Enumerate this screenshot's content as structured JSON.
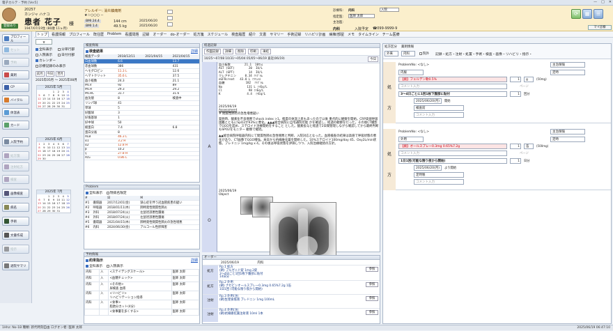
{
  "window": {
    "title": "電子カルテ - 予約 [Ver5]",
    "controls": [
      "—",
      "□",
      "✕"
    ]
  },
  "patient": {
    "id": "20257",
    "kana": "カンジャ ハナコ",
    "name": "患者 花子",
    "honorific": "様",
    "birth": "1947/07/19生 (80歳 11ヶ月)",
    "allergy_label": "アレルギー: 消炎鎮痛剤",
    "stars": "★☆○○○ --",
    "height": "144 cm",
    "weight": "49.5 kg",
    "date1": "2025/06/20",
    "date2": "2025/06/20",
    "badge": "登録あり",
    "bmi1": "BMI 24.4",
    "bmi2": "BMI 1.4",
    "insurance_label": "保険:",
    "insurance": "内科",
    "consult_label": "診療科:",
    "consult": "内科",
    "dept_label": "指定医:",
    "dept": "医師 太郎",
    "disease_label": "主治医:",
    "disease": "",
    "ward": "入院",
    "admit": "入院予定",
    "phone": "☎099-9999-9",
    "ward_label": "内科",
    "settings_label": "マイ診察",
    "colors": {
      "header": "#fbefcc",
      "accent": "#3b78c5",
      "pink": "#fde4e4"
    }
  },
  "tabs": [
    "トップ",
    "看護情報",
    "プロフィール",
    "既往歴",
    "Problem",
    "看護問題",
    "記録",
    "オーダー",
    "do-オーダー",
    "処方箋",
    "スケジュール",
    "検査履歴",
    "紹介",
    "文書",
    "サマリー",
    "手術記録",
    "リハビリ計画",
    "病棟/部屋",
    "メモ",
    "タイムライン",
    "チーム医療"
  ],
  "leftnav": [
    {
      "label": "プロフィール",
      "icon": "profile-icon",
      "color": "#4a7bc0",
      "enabled": true
    },
    {
      "label": "セット",
      "icon": "set-icon",
      "color": "#6aa4d8",
      "enabled": false
    },
    {
      "label": "予約",
      "icon": "calendar-icon",
      "color": "#7c8fa8",
      "enabled": false
    },
    {
      "label": "薬剤",
      "icon": "drug-icon",
      "color": "#c94a4a",
      "enabled": true
    },
    {
      "label": "CP",
      "icon": "cp-icon",
      "color": "#3b5fa8",
      "enabled": true
    },
    {
      "label": "バイタル",
      "icon": "vital-icon",
      "color": "#d77a2b",
      "enabled": true
    },
    {
      "label": "体温表",
      "icon": "chart-icon",
      "color": "#5a9bd5",
      "enabled": true
    },
    {
      "label": "カード",
      "icon": "card-icon",
      "color": "#5aa06a",
      "enabled": true
    },
    {
      "label": "入院予約",
      "icon": "admission-icon",
      "color": "#7a8aa0",
      "enabled": true
    },
    {
      "label": "処方箋",
      "icon": "prescription-icon",
      "color": "#98a",
      "enabled": false
    },
    {
      "label": "注射処方",
      "icon": "injection-icon",
      "color": "#98a",
      "enabled": false
    },
    {
      "label": "検査",
      "icon": "lab-icon",
      "color": "#98a",
      "enabled": false
    },
    {
      "label": "画像検査",
      "icon": "image-icon",
      "color": "#557",
      "enabled": true
    },
    {
      "label": "病名",
      "icon": "disease-icon",
      "color": "#885",
      "enabled": true
    },
    {
      "label": "手術",
      "icon": "surgery-icon",
      "color": "#353",
      "enabled": true
    },
    {
      "label": "文書作成",
      "icon": "doc-icon",
      "color": "#555",
      "enabled": true
    },
    {
      "label": "指示",
      "icon": "order-icon",
      "color": "#777",
      "enabled": false
    },
    {
      "label": "退院サマリ",
      "icon": "summary-icon",
      "color": "#777",
      "enabled": true
    }
  ],
  "filters": {
    "all": "全科表示",
    "admission": "入院表示",
    "calendar": "カレンダー",
    "sub": "分単行部",
    "date": "日付付部",
    "diag": "診療記録のみ表示",
    "period_from": "2025年05月",
    "period_to": "2025年08月",
    "prev": "前月",
    "next": "翌月",
    "today": "今日"
  },
  "calendars": [
    {
      "title": "2025年 5月",
      "days": [
        "",
        "",
        "",
        "1",
        "2",
        "3",
        "4",
        "5",
        "6",
        "7",
        "8",
        "9",
        "10",
        "11",
        "12",
        "13",
        "14",
        "15",
        "16",
        "17",
        "18",
        "19",
        "20",
        "21",
        "22",
        "23",
        "24",
        "25",
        "26",
        "27",
        "28",
        "29",
        "30",
        "31"
      ]
    },
    {
      "title": "2025年 6月",
      "days": [
        "1",
        "2",
        "3",
        "4",
        "5",
        "6",
        "7",
        "8",
        "9",
        "10",
        "11",
        "12",
        "13",
        "14",
        "15",
        "16",
        "17",
        "18",
        "19",
        "20",
        "21",
        "22",
        "23",
        "24",
        "25",
        "26",
        "27",
        "28",
        "29",
        "30"
      ]
    },
    {
      "title": "2025年 7月",
      "days": [
        "",
        "",
        "1",
        "2",
        "3",
        "4",
        "5",
        "6",
        "7",
        "8",
        "9",
        "10",
        "11",
        "12",
        "13",
        "14",
        "15",
        "16",
        "17",
        "18",
        "19",
        "20",
        "21",
        "22",
        "23",
        "24",
        "25",
        "26",
        "27",
        "28",
        "29",
        "30",
        "31"
      ]
    }
  ],
  "lab": {
    "panel_title": "検査情報",
    "section": "検査結果",
    "more": "詳細",
    "cols": [
      "検査データ",
      "2018/12/11",
      "2021/04/15",
      "2021/04/15"
    ],
    "rows": [
      [
        "白血球数",
        "6.6",
        "",
        "13.7"
      ],
      [
        "赤血球数",
        "386",
        "",
        "431"
      ],
      [
        "ヘモグロビン",
        "11.3 L",
        "",
        "12.6"
      ],
      [
        "ヘマトクリット",
        "35.6 L",
        "",
        "37.5"
      ],
      [
        "血小板数",
        "24.3",
        "",
        "21.1"
      ],
      [
        "MCV",
        "92",
        "",
        "89"
      ],
      [
        "MCH",
        "29.3",
        "",
        "29.2"
      ],
      [
        "MCHC",
        "31.7",
        "",
        "31.6"
      ],
      [
        "血沈値",
        "8",
        "",
        "検査中"
      ],
      [
        "リンパ球",
        "41",
        "",
        " "
      ],
      [
        "単球",
        "5",
        "",
        ""
      ],
      [
        "好酸球",
        "3",
        "",
        ""
      ],
      [
        "好塩基球",
        "1",
        "",
        ""
      ],
      [
        "好中球",
        "50",
        "",
        ""
      ],
      [
        "総蛋白",
        "7.4",
        "",
        "6.8"
      ],
      [
        "蛋白分画",
        "8",
        "",
        ""
      ],
      [
        "ALB",
        "46.3 L",
        "",
        ""
      ],
      [
        "α1",
        "3.2 H",
        "",
        ""
      ],
      [
        "α2",
        "12.8 H",
        "",
        ""
      ],
      [
        "β",
        "10.2",
        "",
        ""
      ],
      [
        "γ",
        "27.8 H",
        "",
        ""
      ],
      [
        "A/G",
        "0.86 L",
        "",
        ""
      ]
    ]
  },
  "problem": {
    "panel_title": "Problem",
    "filter_all": "全科表示",
    "filter_status": "現病名限定",
    "cols": [
      "#",
      "",
      "日",
      "M"
    ],
    "rows": [
      [
        "#1",
        "循環器",
        "2017/12/01(金)",
        "狭心症を伴う冠血管疾患の疑い"
      ],
      [
        "#2",
        "呼吸器",
        "2018/01/11(木)",
        "肺特発性間質性肺炎"
      ],
      [
        "#3",
        "外科",
        "2018/07/24(火)",
        "左鼠径部悪性腫瘍"
      ],
      [
        "#4",
        "外科",
        "2018/07/24(火)",
        "左鼠径部悪性腫瘍"
      ],
      [
        "#5",
        "循環器",
        "2021/04/15(木)",
        "肺特発性間質性肺炎の急性増悪"
      ],
      [
        "#6",
        "内科",
        "2024/06/30(金)",
        "アルコール性肝障害"
      ]
    ]
  },
  "reservation": {
    "panel_title": "予約情報",
    "section": "約束指示",
    "more": "詳細",
    "filter_all": "全科表示",
    "filter_adm": "入院表示",
    "rows": [
      [
        "内科",
        "入",
        "<ステイデングスケール>",
        "医師 太郎"
      ],
      [
        "内科",
        "入",
        "<血糖チェック>",
        "医師 太郎"
      ],
      [
        "内科",
        "入",
        "<その他>\n尿検査 血液",
        "医師 太郎"
      ],
      [
        "内科",
        "入",
        "<リハビリ>\nリハビリテーション指導",
        "医師 太郎"
      ],
      [
        "内科",
        "入",
        "<食事>\n脂肪分カット(4分)",
        "医師 太郎"
      ],
      [
        "",
        "",
        "<食事量を多くする>",
        "医師 太郎"
      ]
    ]
  },
  "center": {
    "panel_title": "経過記録",
    "btn_memo": "作図記録",
    "btn_detail": "詳細",
    "btn_delete": "削除",
    "btn_print": "印刷",
    "btn_archive": "凍結",
    "summary_line": "10/25～07/08 10/31～05/04 05/05～06/19  直近(06/19)",
    "today": "今日",
    "labs_block": [
      "血小板数        21.1  10ﾏﾝﾑ",
      "AST (GOT)        20  IU/L",
      "ALT (GPT)        14  IU/L",
      "クレアチニン     0.34 ﾐﾘｸﾞﾗﾑ",
      "eGFRcreat   43.8 L ﾐﾘﾘｯﾄﾙ",
      "血糖            182  ﾐﾘｸﾞﾗﾑ",
      "Na              131 L ﾐﾘEq/L",
      "Cl               98 ﾐﾘEq/L",
      "K               4.4  ﾐﾘEq/L"
    ],
    "assessment_date": "2025/06/19",
    "assessment_title": "Assessment",
    "assessment_head": "# 間質性肺炎の急性増悪疑い",
    "assessment_text": "発熱時、酸素化不良増悪でshock index >1。軽度の体温上昇もあったので以後 重点的に観察を開始。CRP高値呼吸困難とともにSpO2が93%に悪化。▲▲▲総合病院に自宅通院可能 かを確認し、経過の観察を行った。その後CT撮影でGGOを認め、ステロイド治療開始をすること とした。酸素投与と経過で2日間管理しながら確認してから最終判断もSPO2をモニター 観察で継続。",
    "plan_text": "▲▲総合病院呼吸器内科にて間質性肺炎急性増悪と判断、入院対応となった。血液検査の結果は高値で呼吸状態の悪化があり、CT画像でGGO増強。本日から抗線維化薬を開始した。10%ステロイド100mg/day 45、Oxy2L/min状態。ブレドニン 1mg/kg x 4。その後は呼吸状態を評価しつつ、入院治療継続の方針。",
    "objective_date": "2025/06/19",
    "objective_title": "Object",
    "soap": [
      "A",
      "O",
      "S"
    ],
    "order_title": "オーダー",
    "order_date": "2025/06/19",
    "order_dept": "内科",
    "orders": [
      {
        "tag": "処方",
        "head": "Rp.1 処方",
        "lines": [
          "(朝) ブルゼニド錠 1mg 2錠",
          "3～4日ごと1回1枚下腹部に貼付",
          "14日分"
        ],
        "btn": "参照"
      },
      {
        "tag": "処方",
        "head": "Rp.2 外用",
        "lines": [
          "(朝) ナセビンオールスプレー0.3mg 0.65%7.2g 1缶",
          "1日1回 (可能な限り夜から開始)"
        ],
        "btn": "参照"
      },
      {
        "tag": "注射",
        "head": "Rp.3 外用(注)",
        "lines": [
          "(朝)生理食塩液 ブレドニン 1mg 100mL"
        ],
        "btn": "参照"
      },
      {
        "tag": "注射",
        "head": "Rp.4 外用(注)",
        "lines": [
          "(朝)抗線維化薬注射液 10ml 1本"
        ],
        "btn": "参照"
      }
    ]
  },
  "right": {
    "dept_label": "処方区分",
    "dept": "外来",
    "order_label": "薬剤情報",
    "order": "内科",
    "chk_label": "院外",
    "menu": "記録・処方・注射・処置・手術・検査・画像・リハビリ・指示・",
    "blocks": [
      {
        "side_top": "処",
        "side_bot": "方",
        "problem": "ProblemNo: <なし>",
        "route": "内服",
        "dropdown": "主治保険",
        "type": "定時",
        "drug": "【劇】フェルデン軟0.5%",
        "qty": "1",
        "unit": "g",
        "note": "(50mg)",
        "extra": "ページ",
        "instruction": "3～4日ごとに1回1枚下腹部に貼付",
        "days": "1",
        "days_unit": "回分",
        "start": "2025/06/20(月)",
        "start_label": "開始",
        "after": "検査前",
        "comment": "コメント入力"
      },
      {
        "side_top": "処",
        "side_bot": "方",
        "problem": "ProblemNo: <なし>",
        "route": "外用",
        "dropdown": "主治保険",
        "type": "定時",
        "drug": "【劇】オールスプレー0.3mg 0.65%7.2g",
        "qty": "1",
        "unit": "缶",
        "note": "(500mg)",
        "extra": "ページ",
        "instruction": "1日1回(可能な限り夜から開始)",
        "days": "1",
        "days_unit": "日分",
        "start": "2025/06/20(月)",
        "start_label": "より開始",
        "after": "定時製",
        "comment": "コメント入力"
      }
    ]
  },
  "status": {
    "left": "1Hhz: No-1B  種類: 新代時刻自由  ログオン者: 医師 太郎",
    "right": "2025/06/19 06:47:10"
  }
}
